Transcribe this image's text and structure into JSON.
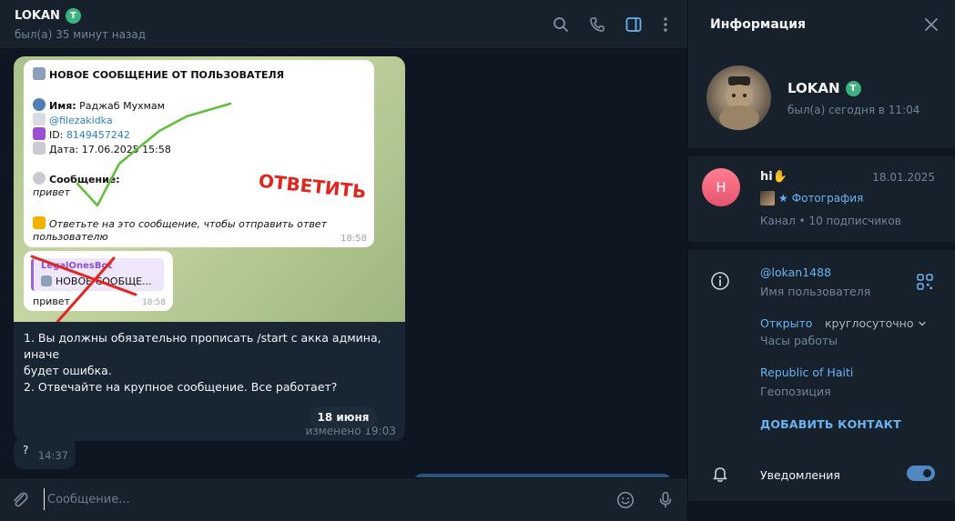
{
  "chat": {
    "title": "LOKAN",
    "premium_letter": "T",
    "status": "был(а) 35 минут назад"
  },
  "card": {
    "heading": "НОВОЕ СООБЩЕНИЕ ОТ ПОЛЬЗОВАТЕЛЯ",
    "name_label": "Имя:",
    "name_value": "Раджаб Мухмам",
    "username": "@filezakidka",
    "id_label": "ID:",
    "id_value": "8149457242",
    "date_label": "Дата:",
    "date_value": "17.06.2025 15:58",
    "message_label": "Сообщение:",
    "message_value": "привет",
    "warning_line1": "Ответьте на это сообщение, чтобы отправить ответ",
    "warning_line2": "пользователю",
    "time": "18:58",
    "handwriting": "ОТВЕТИТЬ"
  },
  "reply_card": {
    "sender": "LegalOnesBot",
    "quote": "НОВОЕ СООБЩЕ...",
    "body": "привет",
    "time": "18:58"
  },
  "message": {
    "line1": "1. Вы должны обязательно прописать /start с акка админа, иначе",
    "line2": "будет ошибка.",
    "line3": "2. Отвечайте на крупное сообщение. Все работает?",
    "edited": "изменено 19:03"
  },
  "date_separator": "18 июня",
  "small_message": {
    "text": "?",
    "time": "14:37"
  },
  "composer": {
    "placeholder": "Сообщение..."
  },
  "info": {
    "title": "Информация",
    "name": "LOKAN",
    "premium_letter": "T",
    "status": "был(а) сегодня в 11:04",
    "channel": {
      "avatar_letter": "H",
      "name": "hi✋",
      "date": "18.01.2025",
      "preview": "Фотография",
      "subtitle": "Канал • 10 подписчиков"
    },
    "username": "@lokan1488",
    "username_label": "Имя пользователя",
    "hours_status": "Открыто",
    "hours_value": "круглосуточно",
    "hours_label": "Часы работы",
    "location": "Republic of Haiti",
    "location_label": "Геопозиция",
    "add_contact": "ДОБАВИТЬ КОНТАКТ",
    "notifications_label": "Уведомления",
    "notifications_on": true
  },
  "colors": {
    "accent": "#6ab3f3",
    "premium": "#3cb280",
    "toggle": "#5288c1"
  }
}
